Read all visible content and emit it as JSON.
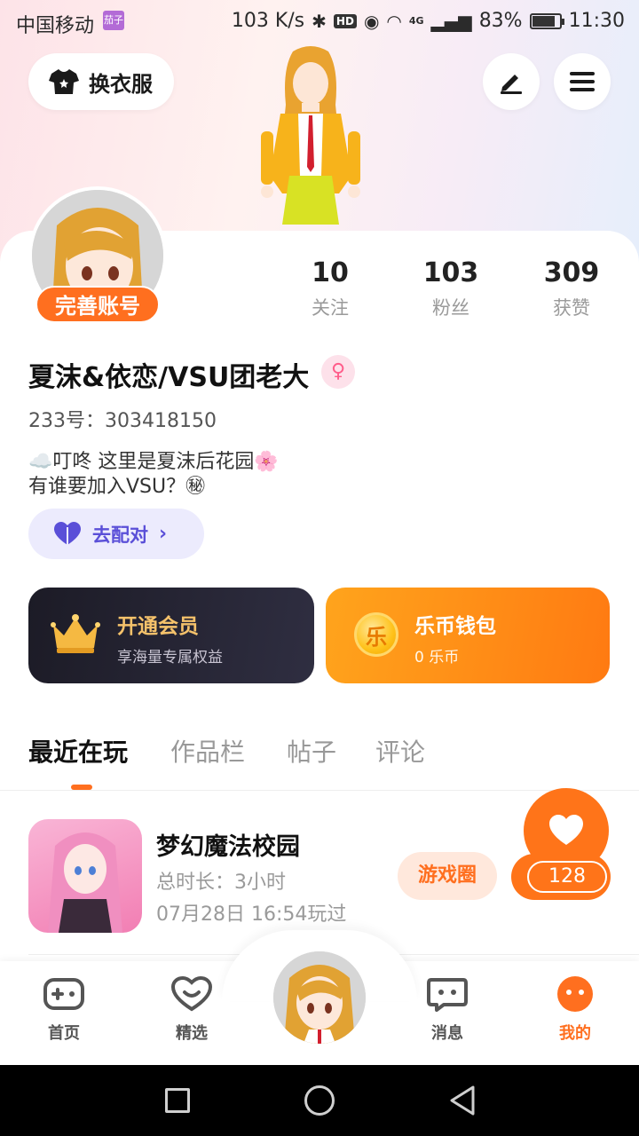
{
  "status_bar": {
    "carrier": "中国移动",
    "carrier_badge": "茄子",
    "speed": "103 K/s",
    "hd": "HD",
    "network": "4G",
    "battery": "83%",
    "time": "11:30"
  },
  "header": {
    "outfit_label": "换衣服"
  },
  "profile": {
    "complete_label": "完善账号",
    "stats": [
      {
        "value": "10",
        "label": "关注"
      },
      {
        "value": "103",
        "label": "粉丝"
      },
      {
        "value": "309",
        "label": "获赞"
      }
    ],
    "username": "夏沫&依恋/VSU团老大",
    "gender_symbol": "♀",
    "uid_label": "233号：",
    "uid": "303418150",
    "bio_line1": "☁️叮咚  这里是夏沫后花园🌸",
    "bio_line2": "有谁要加入VSU？㊙",
    "match_label": "去配对"
  },
  "cards": {
    "vip_title": "开通会员",
    "vip_sub": "享海量专属权益",
    "wallet_title": "乐币钱包",
    "wallet_sub": "0 乐币",
    "coin_glyph": "乐"
  },
  "tabs": [
    "最近在玩",
    "作品栏",
    "帖子",
    "评论"
  ],
  "game": {
    "name": "梦幻魔法校园",
    "duration": "总时长：3小时",
    "last_played": "07月28日 16:54玩过",
    "circle_label": "游戏圈",
    "like_count": "128"
  },
  "nav": {
    "home": "首页",
    "featured": "精选",
    "messages": "消息",
    "mine": "我的"
  },
  "colors": {
    "accent": "#ff6f1f",
    "match": "#5a4fd8",
    "vip_gold": "#f5c26b"
  }
}
